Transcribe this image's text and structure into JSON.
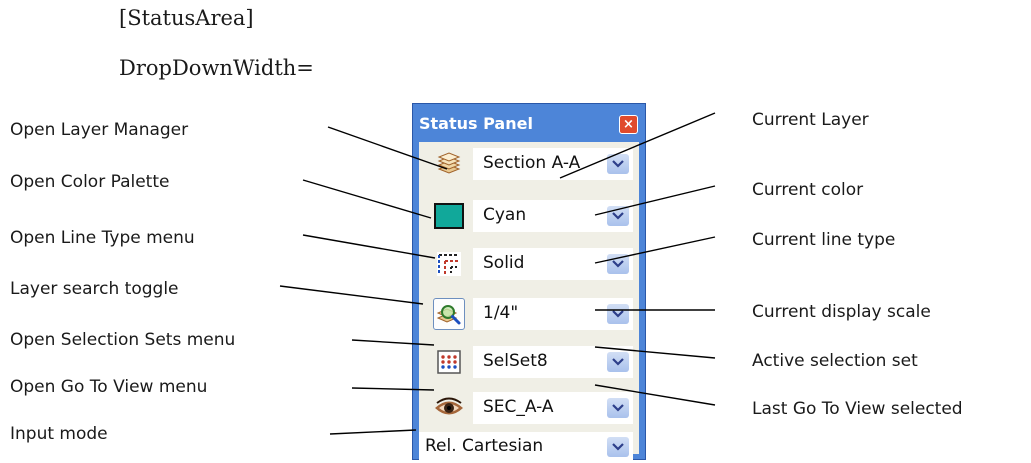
{
  "heading": {
    "line1": "[StatusArea]",
    "line2": "DropDownWidth="
  },
  "left_callouts": [
    "Open Layer Manager",
    "Open Color Palette",
    "Open Line Type menu",
    "Layer search toggle",
    "Open Selection Sets menu",
    "Open Go To View menu",
    "Input mode"
  ],
  "right_callouts": [
    "Current Layer",
    "Current color",
    "Current line type",
    "Current display scale",
    "Active selection set",
    "Last Go To View selected"
  ],
  "panel": {
    "title": "Status Panel",
    "close_glyph": "×",
    "rows": [
      {
        "icon": "layers-icon",
        "value": "Section A-A"
      },
      {
        "icon": "color-swatch-icon",
        "value": "Cyan",
        "swatch_color": "#11a89a"
      },
      {
        "icon": "line-type-icon",
        "value": "Solid"
      },
      {
        "icon": "layer-search-icon",
        "value": "1/4\""
      },
      {
        "icon": "selection-sets-icon",
        "value": "SelSet8"
      },
      {
        "icon": "eye-icon",
        "value": "SEC_A-A"
      },
      {
        "value": "Rel. Cartesian"
      }
    ]
  },
  "colors": {
    "title_bar": "#4d85d8",
    "close_button": "#e04a2c",
    "panel_body": "#f0efe6"
  }
}
